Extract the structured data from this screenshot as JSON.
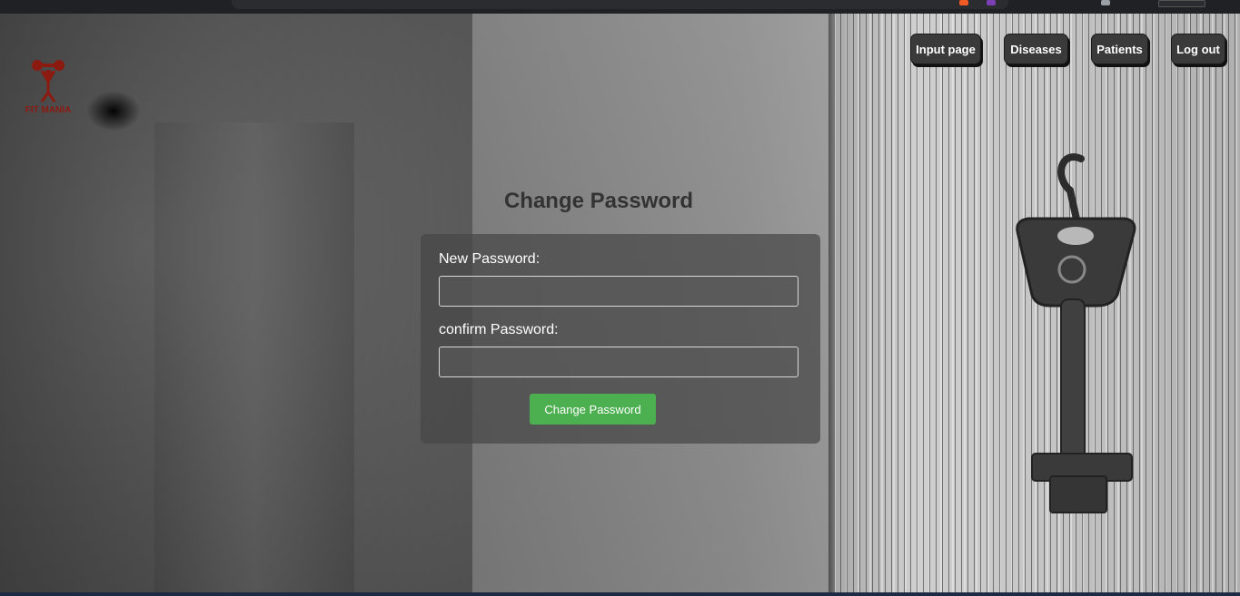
{
  "logo": {
    "text": "FIT MANIA",
    "icon": "weightlifter-icon",
    "color": "#8b1a10"
  },
  "nav": {
    "input_page": "Input page",
    "diseases": "Diseases",
    "patients": "Patients",
    "logout": "Log out"
  },
  "form": {
    "title": "Change Password",
    "new_password_label": "New Password:",
    "new_password_value": "",
    "confirm_password_label": "confirm Password:",
    "confirm_password_value": "",
    "submit_label": "Change Password"
  },
  "colors": {
    "submit_button": "#4caf50",
    "nav_button": "#3a3a3a",
    "title": "#333333"
  },
  "background": {
    "image": "key-on-wood-icon"
  }
}
